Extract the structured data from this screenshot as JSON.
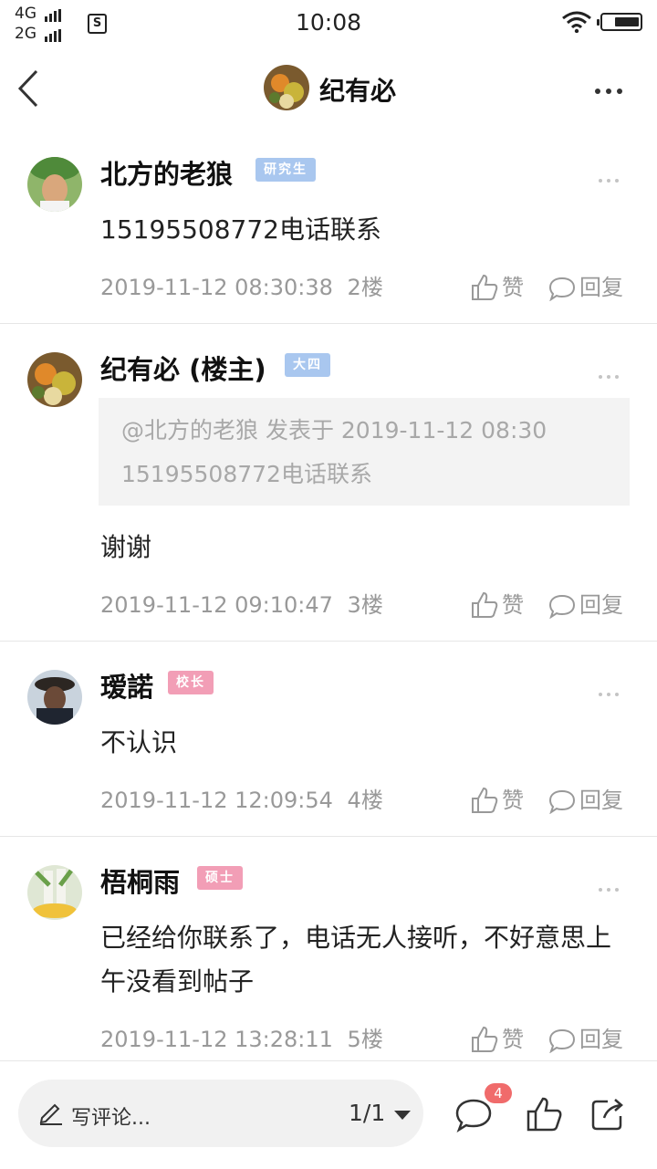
{
  "status_bar": {
    "network_top": "4G",
    "network_bottom": "2G",
    "sim_label": "S",
    "time": "10:08"
  },
  "nav": {
    "title": "纪有必"
  },
  "posts": [
    {
      "author": "北方的老狼",
      "badge": "研究生",
      "badge_color": "#a9c7ef",
      "content": "15195508772电话联系",
      "date": "2019-11-12 08:30:38",
      "floor": "2楼",
      "like_label": "赞",
      "reply_label": "回复"
    },
    {
      "author": "纪有必 (楼主)",
      "badge": "大四",
      "badge_color": "#a9c7ef",
      "quote_header": "@北方的老狼 发表于 2019-11-12 08:30",
      "quote_text": "15195508772电话联系",
      "content": "谢谢",
      "date": "2019-11-12 09:10:47",
      "floor": "3楼",
      "like_label": "赞",
      "reply_label": "回复"
    },
    {
      "author": "瑷諾",
      "badge": "校长",
      "badge_color": "#f29eb6",
      "content": "不认识",
      "date": "2019-11-12 12:09:54",
      "floor": "4楼",
      "like_label": "赞",
      "reply_label": "回复"
    },
    {
      "author": "梧桐雨",
      "badge": "硕士",
      "badge_color": "#f29eb6",
      "content": "已经给你联系了，电话无人接听，不好意思上午没看到帖子",
      "date": "2019-11-12 13:28:11",
      "floor": "5楼",
      "like_label": "赞",
      "reply_label": "回复"
    }
  ],
  "bottom_bar": {
    "comment_placeholder": "写评论...",
    "page_indicator": "1/1",
    "comment_count": "4"
  },
  "icons": {
    "back": "back-arrow-icon",
    "more": "more-dots-icon",
    "like": "thumbs-up-icon",
    "reply": "speech-bubble-icon",
    "share": "share-icon",
    "pencil": "pencil-icon"
  },
  "colors": {
    "accent_badge_red": "#f06b6b",
    "meta_gray": "#999999"
  }
}
